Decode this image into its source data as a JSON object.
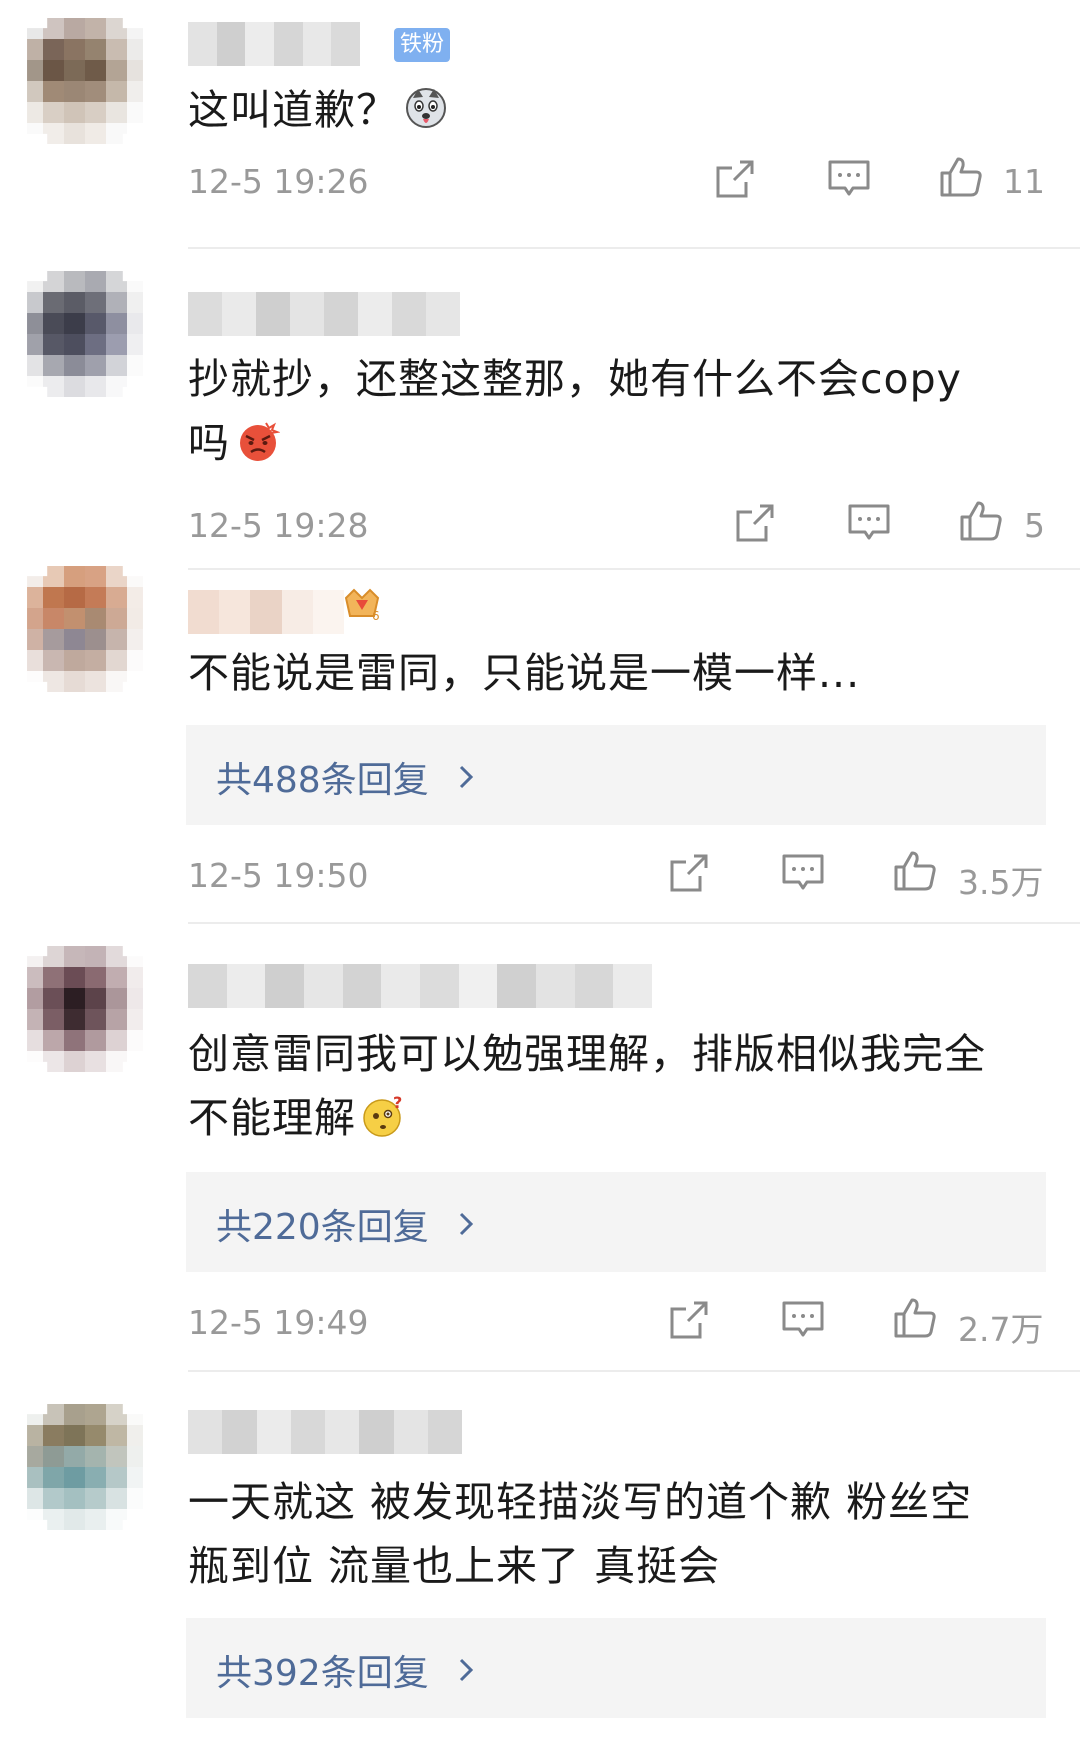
{
  "comments": [
    {
      "badge": "铁粉",
      "text": "这叫道歉？",
      "emoji_name": "husky-emoji",
      "time": "12-5 19:26",
      "likes": "11",
      "avatar_colors": [
        "#e8e8e8",
        "#cfc4c0",
        "#b9a9a2",
        "#c2b3a9",
        "#dcd6d1",
        "#f4f4f4",
        "#bfb1a6",
        "#7a6558",
        "#8a7462",
        "#95836f",
        "#c9bcb1",
        "#ecebea",
        "#a29689",
        "#6b5646",
        "#7c6a57",
        "#6f5b49",
        "#b3a495",
        "#e6e2de",
        "#d1c8be",
        "#a08a76",
        "#9b8775",
        "#a18d7b",
        "#c5b8aa",
        "#f0eeec",
        "#ede9e4",
        "#d9cfc5",
        "#d0c4b8",
        "#d8cec4",
        "#e9e5e0",
        "#fafafa",
        "#fafafa",
        "#f1ede9",
        "#e8e2dc",
        "#f0ebe6",
        "#f9f9f9",
        "#ffffff"
      ]
    },
    {
      "text_line1": "抄就抄，还整这整那，她有什么不会copy",
      "text_line2": "吗",
      "emoji_name": "angry-face-emoji",
      "time": "12-5 19:28",
      "likes": "5",
      "avatar_colors": [
        "#f1f1f1",
        "#d4d4d6",
        "#b9babe",
        "#a9aab1",
        "#d5d6d8",
        "#fafafa",
        "#c8c9cd",
        "#6a6b73",
        "#5b5c66",
        "#6e6f79",
        "#b0b1b8",
        "#f0f0f0",
        "#8e8f98",
        "#4a4b57",
        "#3c3d4a",
        "#58596a",
        "#8e8fa0",
        "#e9e9ec",
        "#a0a1aa",
        "#575866",
        "#4d4e5e",
        "#6d6e82",
        "#9c9daf",
        "#efeff1",
        "#e3e3e5",
        "#a7a8b0",
        "#8b8c98",
        "#9fa0ac",
        "#d2d3d8",
        "#fbfbfb",
        "#fbfbfb",
        "#ececee",
        "#dcdce0",
        "#e8e8eb",
        "#f8f8f9",
        "#ffffff"
      ]
    },
    {
      "text": "不能说是雷同，只能说是一模一样...",
      "replies": "共488条回复",
      "time": "12-5 19:50",
      "likes": "3.5万",
      "avatar_colors": [
        "#f3ede9",
        "#e7c9b5",
        "#d69f7e",
        "#d8a284",
        "#ead5c8",
        "#fbfaf9",
        "#dcb39b",
        "#c0774f",
        "#b66a45",
        "#c47b57",
        "#d8ab92",
        "#f3ece7",
        "#d3a48c",
        "#c88768",
        "#c2906f",
        "#a98a72",
        "#cda995",
        "#f2ebe6",
        "#cfb2a5",
        "#a69b9d",
        "#8e8793",
        "#9c8f8e",
        "#c6b4ac",
        "#f3efed",
        "#e9dfdb",
        "#c9b7b1",
        "#bfa99d",
        "#c4aea2",
        "#e2d7d1",
        "#fcfbfb",
        "#fdfcfc",
        "#eee7e3",
        "#e6dbd5",
        "#ece3de",
        "#f9f7f6",
        "#ffffff"
      ]
    },
    {
      "text_line1": "创意雷同我可以勉强理解，排版相似我完全",
      "text_line2": "不能理解",
      "emoji_name": "thinking-face-emoji",
      "replies": "共220条回复",
      "time": "12-5 19:49",
      "likes": "2.7万",
      "avatar_colors": [
        "#f4f1f1",
        "#ddd5d5",
        "#c6b7b9",
        "#c3b3b6",
        "#e2dadb",
        "#fcfbfb",
        "#cbbcbe",
        "#8f7177",
        "#6b4c55",
        "#8a6a71",
        "#c1adb0",
        "#f1ecec",
        "#b29da1",
        "#6b4f57",
        "#2c1e23",
        "#5c434a",
        "#ab969a",
        "#eee8e9",
        "#c4b3b5",
        "#7b5e65",
        "#3e2c31",
        "#6e545b",
        "#b7a3a6",
        "#f2eded",
        "#e6dedf",
        "#bca7aa",
        "#8f737a",
        "#b09a9e",
        "#ddd2d3",
        "#fcfbfb",
        "#fdfcfc",
        "#ece6e7",
        "#ddd2d3",
        "#e8e0e1",
        "#f9f7f7",
        "#ffffff"
      ]
    },
    {
      "text_line1": "一天就这 被发现轻描淡写的道个歉 粉丝空",
      "text_line2": "瓶到位 流量也上来了 真挺会",
      "replies": "共392条回复",
      "avatar_colors": [
        "#eef0ee",
        "#c8c3b8",
        "#a8a08d",
        "#aea590",
        "#d6d2c8",
        "#fafaf9",
        "#b9b3a2",
        "#8a7c60",
        "#7e7458",
        "#968a6c",
        "#bfb7a4",
        "#f0efec",
        "#a7a99f",
        "#8e9b95",
        "#93aaa8",
        "#a4b4ae",
        "#c1c5bd",
        "#eef0ee",
        "#a9c0c0",
        "#7fa6a9",
        "#6e9ca2",
        "#89aeb1",
        "#b5c8c8",
        "#f1f4f4",
        "#dde6e6",
        "#b2c9ca",
        "#a4c0c1",
        "#b6cbcb",
        "#d8e2e2",
        "#fbfcfc",
        "#fcfdfd",
        "#eaf0f0",
        "#e1e9e9",
        "#e9efef",
        "#f8fafa",
        "#ffffff"
      ]
    }
  ],
  "icons": {
    "share": "share-icon",
    "comment": "comment-icon",
    "like": "thumbs-up-icon",
    "chevron": "chevron-right-icon"
  },
  "colors": {
    "link": "#4f6b98",
    "meta": "#999999",
    "badge": "#7fb0f0",
    "reply_bg": "#f4f4f4"
  }
}
